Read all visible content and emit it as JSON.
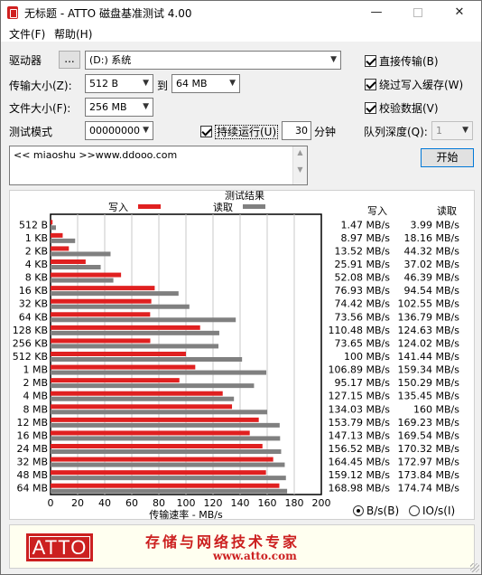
{
  "window": {
    "title": "无标题 - ATTO 磁盘基准测试 4.00",
    "minimize": "—",
    "close": "✕"
  },
  "menu": {
    "file": "文件(F)",
    "help": "帮助(H)"
  },
  "controls": {
    "drive_label": "驱动器",
    "browse_label": "...",
    "drive_value": "(D:) 系统",
    "transfer_label": "传输大小(Z):",
    "transfer_from": "512 B",
    "to_label": "到",
    "transfer_to": "64 MB",
    "filesize_label": "文件大小(F):",
    "filesize_value": "256 MB",
    "mode_label": "测试模式",
    "mode_value": "00000000",
    "continuous_label": "持续运行(U)",
    "continuous_value": "30",
    "minutes_label": "分钟",
    "direct_io_label": "直接传输(B)",
    "bypass_cache_label": "绕过写入缓存(W)",
    "verify_label": "校验数据(V)",
    "queue_label": "队列深度(Q):",
    "queue_value": "1",
    "start_label": "开始",
    "description": "<< miaoshu >>www.ddooo.com"
  },
  "results": {
    "title": "测试结果",
    "legend_write": "写入",
    "legend_read": "读取",
    "col_write": "写入",
    "col_read": "读取",
    "xaxis_title": "传输速率 - MB/s",
    "write_values": [
      "1.47 MB/s",
      "8.97 MB/s",
      "13.52 MB/s",
      "25.91 MB/s",
      "52.08 MB/s",
      "76.93 MB/s",
      "74.42 MB/s",
      "73.56 MB/s",
      "110.48 MB/s",
      "73.65 MB/s",
      "100 MB/s",
      "106.89 MB/s",
      "95.17 MB/s",
      "127.15 MB/s",
      "134.03 MB/s",
      "153.79 MB/s",
      "147.13 MB/s",
      "156.52 MB/s",
      "164.45 MB/s",
      "159.12 MB/s",
      "168.98 MB/s"
    ],
    "read_values": [
      "3.99 MB/s",
      "18.16 MB/s",
      "44.32 MB/s",
      "37.02 MB/s",
      "46.39 MB/s",
      "94.54 MB/s",
      "102.55 MB/s",
      "136.79 MB/s",
      "124.63 MB/s",
      "124.02 MB/s",
      "141.44 MB/s",
      "159.34 MB/s",
      "150.29 MB/s",
      "135.45 MB/s",
      "160 MB/s",
      "169.23 MB/s",
      "169.54 MB/s",
      "170.32 MB/s",
      "172.97 MB/s",
      "173.84 MB/s",
      "174.74 MB/s"
    ]
  },
  "chart_data": {
    "type": "bar",
    "orientation": "horizontal",
    "categories": [
      "512 B",
      "1 KB",
      "2 KB",
      "4 KB",
      "8 KB",
      "16 KB",
      "32 KB",
      "64 KB",
      "128 KB",
      "256 KB",
      "512 KB",
      "1 MB",
      "2 MB",
      "4 MB",
      "8 MB",
      "12 MB",
      "16 MB",
      "24 MB",
      "32 MB",
      "48 MB",
      "64 MB"
    ],
    "series": [
      {
        "name": "写入",
        "color": "#e02020",
        "values": [
          1.47,
          8.97,
          13.52,
          25.91,
          52.08,
          76.93,
          74.42,
          73.56,
          110.48,
          73.65,
          100,
          106.89,
          95.17,
          127.15,
          134.03,
          153.79,
          147.13,
          156.52,
          164.45,
          159.12,
          168.98
        ]
      },
      {
        "name": "读取",
        "color": "#808080",
        "values": [
          3.99,
          18.16,
          44.32,
          37.02,
          46.39,
          94.54,
          102.55,
          136.79,
          124.63,
          124.02,
          141.44,
          159.34,
          150.29,
          135.45,
          160,
          169.23,
          169.54,
          170.32,
          172.97,
          173.84,
          174.74
        ]
      }
    ],
    "xlim": [
      0,
      200
    ],
    "xticks": [
      "0",
      "20",
      "40",
      "60",
      "80",
      "100",
      "120",
      "140",
      "160",
      "180",
      "200"
    ],
    "xlabel": "传输速率 - MB/s",
    "grid": true,
    "legend": "top"
  },
  "units": {
    "bs_label": "B/s(B)",
    "ios_label": "IO/s(I)"
  },
  "footer": {
    "logo": "ATTO",
    "slogan": "存储与网络技术专家",
    "url": "www.atto.com"
  }
}
